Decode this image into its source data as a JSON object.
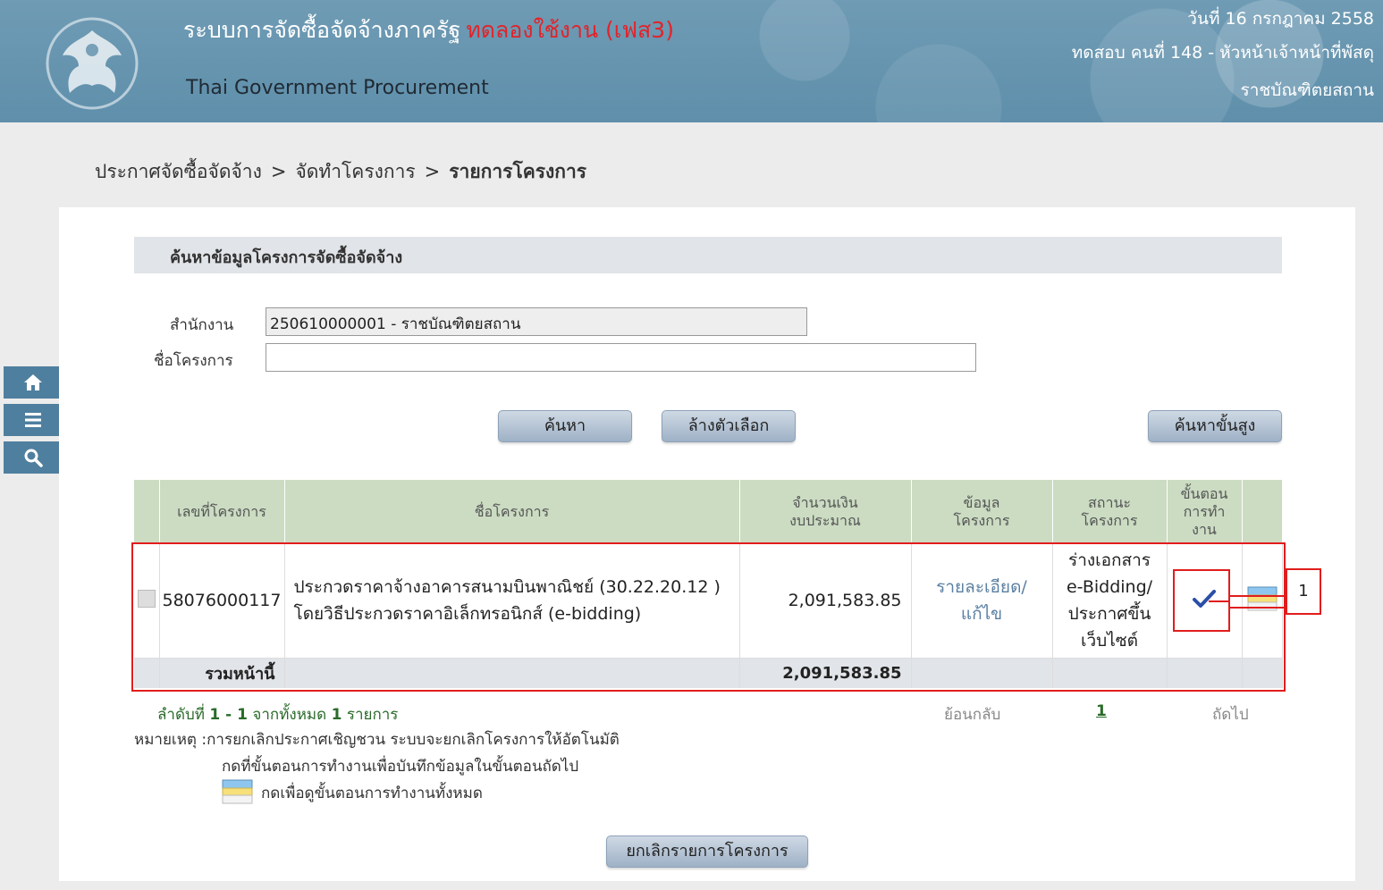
{
  "header": {
    "title_th": "ระบบการจัดซื้อจัดจ้างภาครัฐ",
    "title_trial": "ทดลองใช้งาน (เฟส3)",
    "subtitle": "Thai Government Procurement",
    "date": "วันที่ 16 กรกฎาคม 2558",
    "user": "ทดสอบ คนที่ 148 - หัวหน้าเจ้าหน้าที่พัสดุ",
    "org": "ราชบัณฑิตยสถาน"
  },
  "breadcrumb": {
    "item1": "ประกาศจัดซื้อจัดจ้าง",
    "item2": "จัดทำโครงการ",
    "item3": "รายการโครงการ",
    "sep": ">"
  },
  "search": {
    "heading": "ค้นหาข้อมูลโครงการจัดซื้อจัดจ้าง",
    "office_label": "สำนักงาน",
    "office_value": "250610000001 - ราชบัณฑิตยสถาน",
    "project_label": "ชื่อโครงการ",
    "project_value": "",
    "search_btn": "ค้นหา",
    "clear_btn": "ล้างตัวเลือก",
    "advanced_btn": "ค้นหาขั้นสูง"
  },
  "table": {
    "headers": {
      "project_no": "เลขที่โครงการ",
      "project_name": "ชื่อโครงการ",
      "budget_1": "จำนวนเงิน",
      "budget_2": "งบประมาณ",
      "info_1": "ข้อมูล",
      "info_2": "โครงการ",
      "status_1": "สถานะ",
      "status_2": "โครงการ",
      "step_1": "ขั้นตอน",
      "step_2": "การทำ",
      "step_3": "งาน"
    },
    "rows": [
      {
        "project_no": "58076000117",
        "name_line1": "ประกวดราคาจ้างอาคารสนามบินพาณิชย์ (30.22.20.12 )",
        "name_line2": "โดยวิธีประกวดราคาอิเล็กทรอนิกส์ (e-bidding)",
        "budget": "2,091,583.85",
        "info_line1": "รายละเอียด/",
        "info_line2": "แก้ไข",
        "status_line1": "ร่างเอกสาร",
        "status_line2": "e-Bidding/",
        "status_line3": "ประกาศขึ้น",
        "status_line4": "เว็บไซต์"
      }
    ],
    "total_label": "รวมหน้านี้",
    "total_value": "2,091,583.85"
  },
  "callout": "1",
  "pagination": {
    "summary_prefix": "ลำดับที่",
    "range": "1 - 1",
    "summary_mid": "จากทั้งหมด",
    "count": "1",
    "summary_suffix": "รายการ",
    "prev": "ย้อนกลับ",
    "page": "1",
    "next": "ถัดไป"
  },
  "notes": {
    "line1": "หมายเหตุ :การยกเลิกประกาศเชิญชวน ระบบจะยกเลิกโครงการให้อัตโนมัติ",
    "line2": "กดที่ขั้นตอนการทำงานเพื่อบันทึกข้อมูลในขั้นตอนถัดไป",
    "line3": "กดเพื่อดูขั้นตอนการทำงานทั้งหมด"
  },
  "cancel_btn": "ยกเลิกรายการโครงการ",
  "colors": {
    "header_bg": "#6f9bb4",
    "trial_text": "#e2232a",
    "table_header_bg": "#cbdcc2",
    "highlight_red": "#e11d1d"
  }
}
